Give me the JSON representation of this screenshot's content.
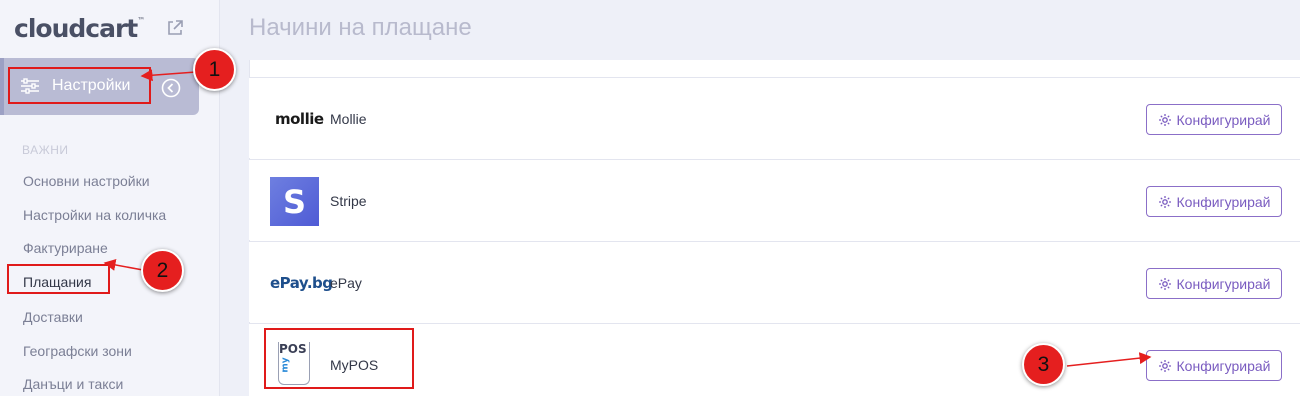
{
  "app": {
    "logo_text": "cloudcart",
    "logo_tm": "™"
  },
  "sidebar": {
    "settings_label": "Настройки",
    "section_title": "ВАЖНИ",
    "items": [
      {
        "label": "Основни настройки"
      },
      {
        "label": "Настройки на количка"
      },
      {
        "label": "Фактуриране"
      },
      {
        "label": "Плащания"
      },
      {
        "label": "Доставки"
      },
      {
        "label": "Географски зони"
      },
      {
        "label": "Данъци и такси"
      }
    ]
  },
  "main": {
    "title": "Начини на плащане",
    "configure_label": "Конфигурирай",
    "providers": [
      {
        "name": "Mollie",
        "logo_text": "mollie"
      },
      {
        "name": "Stripe",
        "logo_text": "S"
      },
      {
        "name": "ePay",
        "logo_text": "ePay.bg"
      },
      {
        "name": "MyPOS",
        "logo_text_pos": "POS",
        "logo_text_my": "my"
      }
    ]
  },
  "annotations": {
    "badges": [
      "1",
      "2",
      "3"
    ]
  },
  "colors": {
    "accent_purple": "#7a5cc0",
    "highlight_red": "#e01a1a",
    "badge_red": "#e51f1f",
    "sidebar_active": "#b9bbd4"
  }
}
